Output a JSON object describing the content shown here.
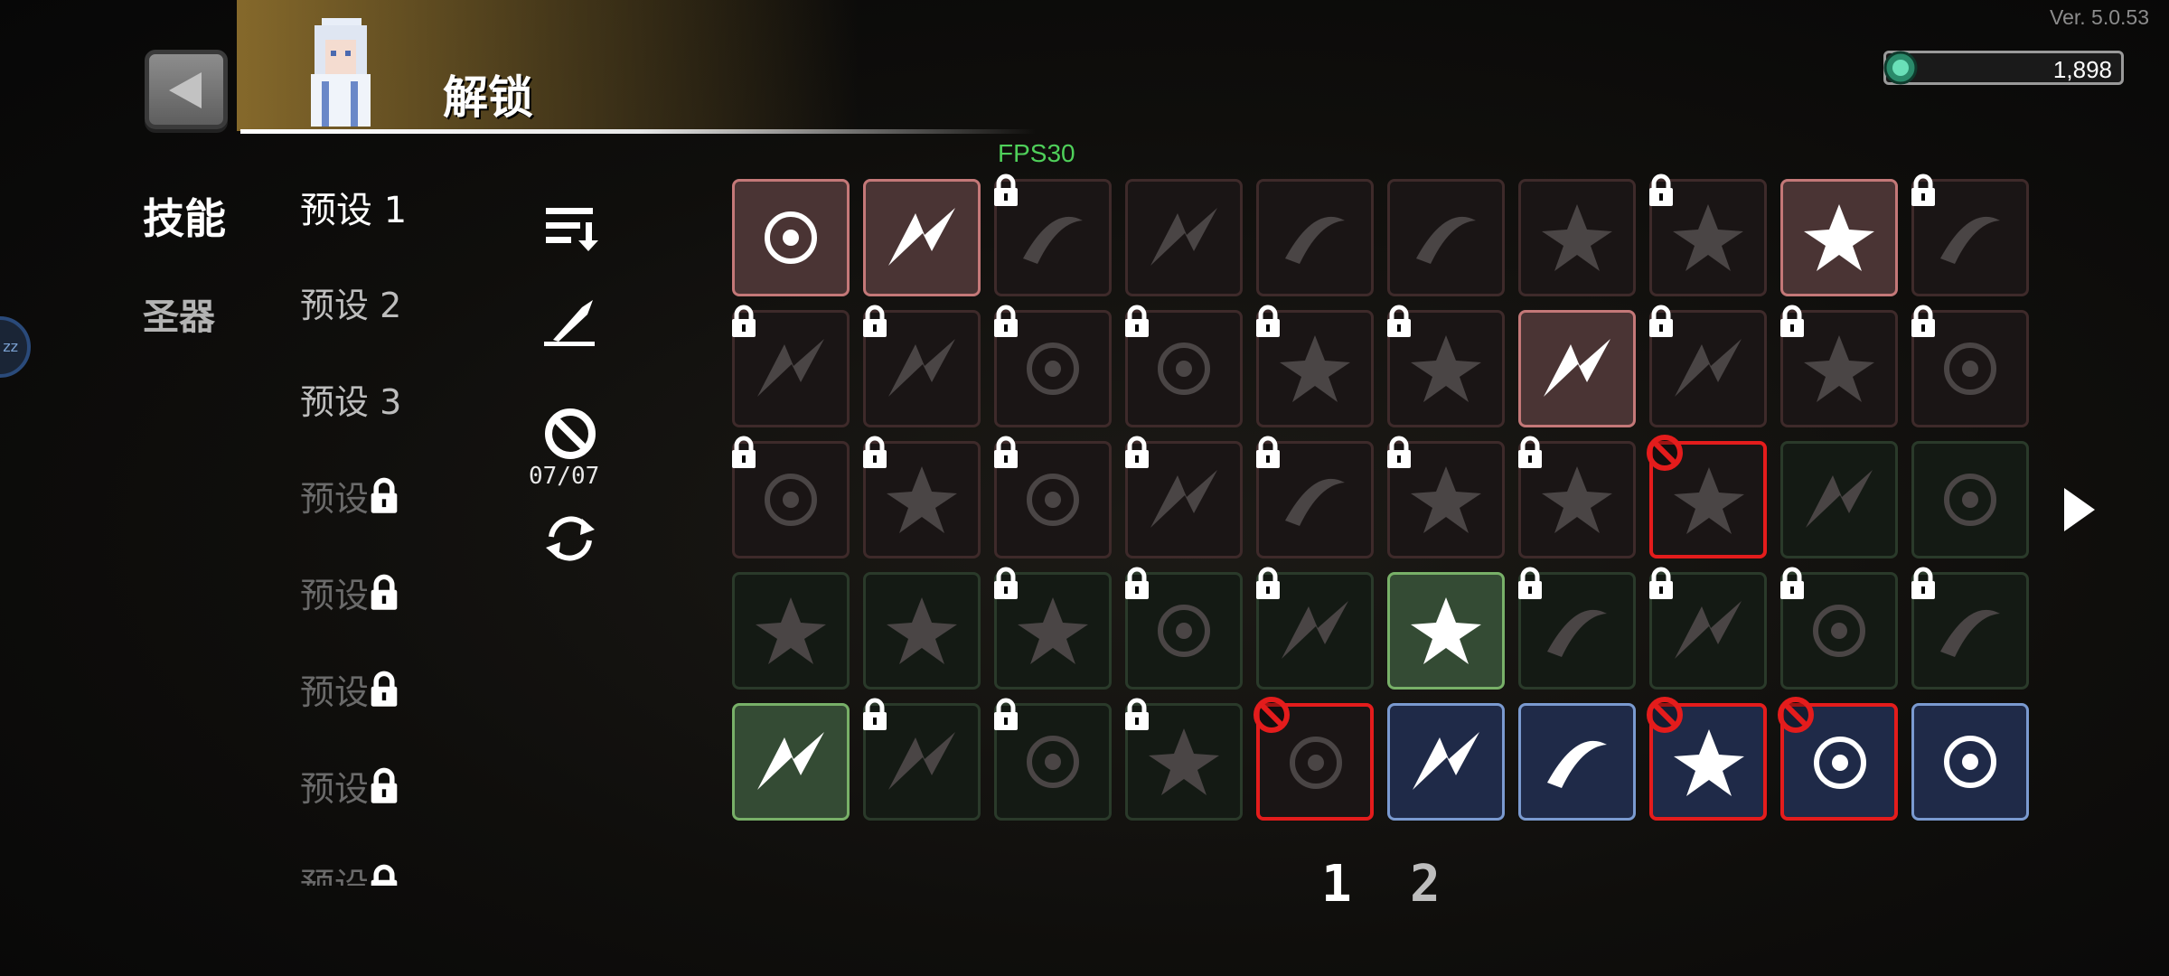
{
  "version": "Ver. 5.0.53",
  "header": {
    "title": "解锁",
    "currency_value": "1,898"
  },
  "fps": "FPS30",
  "categories": {
    "skill": "技能",
    "relic": "圣器"
  },
  "presets": [
    {
      "label": "预设 1",
      "state": "active"
    },
    {
      "label": "预设 2",
      "state": "normal"
    },
    {
      "label": "预设 3",
      "state": "normal"
    },
    {
      "label": "预设",
      "state": "locked"
    },
    {
      "label": "预设",
      "state": "locked"
    },
    {
      "label": "预设",
      "state": "locked"
    },
    {
      "label": "预设",
      "state": "locked"
    },
    {
      "label": "预设",
      "state": "locked"
    }
  ],
  "tools": {
    "ban_counter": "07/07"
  },
  "grid": [
    [
      "act-red:slash-orbit-icon",
      "act-red:sword-swirl-icon",
      "dim-red:lock:beast-claw-icon",
      "dim-red:burst-star-icon",
      "dim-red:arrows-cross-icon",
      "dim-red:snow-orb-icon",
      "dim-red:fire-orb-icon",
      "dim-red:lock:vortex-thorn-icon",
      "act-red:arrow-rain-icon",
      "dim-red:lock:skull-cloud-icon"
    ],
    [
      "dim-red:lock:moon-claw-icon",
      "dim-red:lock:feather-wave-icon",
      "dim-red:lock:wing-blade-icon",
      "dim-red:lock:cross-target-icon",
      "dim-red:lock:frost-sword-icon",
      "dim-red:lock:spiral-wind-icon",
      "act-red:target-orb-icon",
      "dim-red:lock:thorn-spear-icon",
      "dim-red:lock:cloud-burst-icon",
      "dim-red:lock:gauntlet-icon"
    ],
    [
      "dim-red:lock:ring-wave-icon",
      "dim-red:lock:comet-icon",
      "dim-red:lock:thunder-orb-icon",
      "dim-red:lock:claw-slash-icon",
      "dim-red:lock:spear-icon",
      "dim-red:lock:cross-slash-icon",
      "dim-red:lock:spike-wave-icon",
      "dim-red:banned:ground-spike-icon",
      "dim-green:vine-ring-icon",
      "dim-green:lightning-icon"
    ],
    [
      "dim-green:statue-icon",
      "dim-green:vortex-flame-icon",
      "dim-green:lock:skull-burst-icon",
      "dim-green:lock:biohazard-icon",
      "dim-green:lock:lance-icon",
      "act-green:flame-bomb-icon",
      "dim-green:lock:crescent-icon",
      "dim-green:lock:dagger-rain-icon",
      "dim-green:lock:winged-eye-icon",
      "dim-green:lock:spark-icon"
    ],
    [
      "act-green:splash-icon",
      "dim-green:lock:crystal-shard-icon",
      "dim-green:lock:tri-blade-icon",
      "dim-green:lock:chain-ring-icon",
      "dim-red:banned:dash-icon",
      "act-blue:hex-shield-icon",
      "act-blue:ghost-flame-icon",
      "act-blue:banned:hourglass-up-icon",
      "act-blue:banned:boot-up-icon",
      "act-blue:boot-arrow-icon"
    ]
  ],
  "pagination": {
    "page1": "1",
    "page2": "2"
  },
  "colors": {
    "accent_gold": "#8c6e2d",
    "ban_red": "#e41c1c",
    "fps_green": "#4fd05a"
  }
}
